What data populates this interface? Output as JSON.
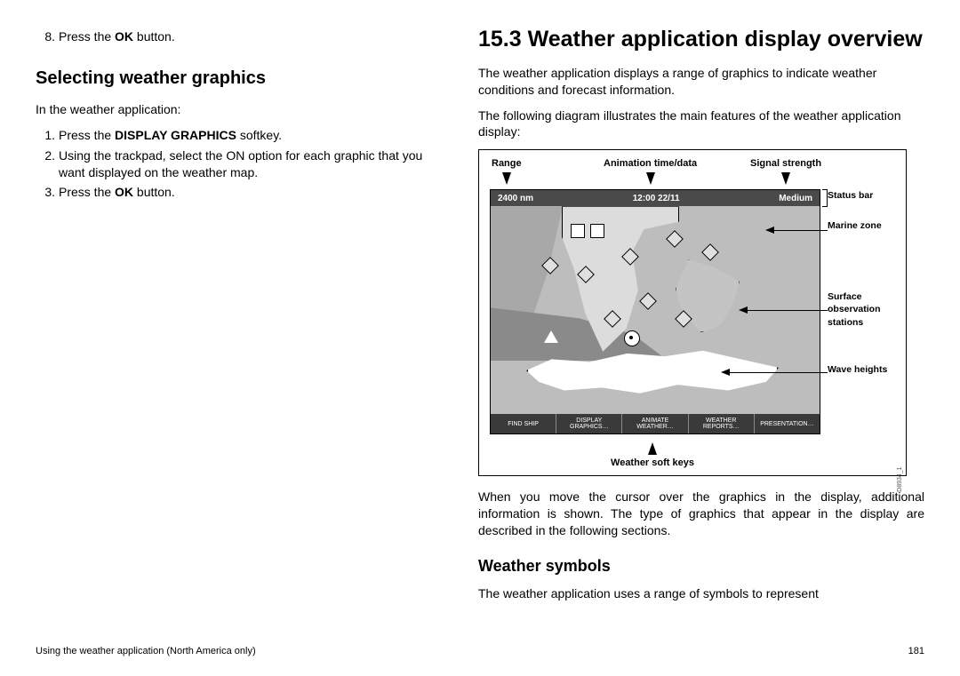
{
  "left": {
    "step8_pre": "Press the ",
    "step8_bold": "OK",
    "step8_post": " button.",
    "heading": "Selecting weather graphics",
    "intro": "In the weather application:",
    "s1_pre": "Press the ",
    "s1_bold": "DISPLAY GRAPHICS",
    "s1_post": " softkey.",
    "s2": "Using the trackpad, select the ON option for each graphic that you want displayed on the weather map.",
    "s3_pre": "Press the ",
    "s3_bold": "OK",
    "s3_post": " button."
  },
  "right": {
    "h1": "15.3 Weather application display overview",
    "p1": "The weather application displays a range of graphics to indicate weather conditions and forecast information.",
    "p2": "The following diagram illustrates the main features of the weather application display:",
    "p3": "When you move the cursor over the graphics in the display, additional information is shown. The type of graphics that appear in the display are described in the following sections.",
    "h3": "Weather symbols",
    "p4": "The weather application uses a range of symbols to represent"
  },
  "figure": {
    "top": {
      "range": "Range",
      "anim": "Animation time/data",
      "signal": "Signal strength"
    },
    "status": {
      "left": "2400 nm",
      "center": "12:00 22/11",
      "right": "Medium"
    },
    "softkeys": {
      "k1": "FIND SHIP",
      "k2a": "DISPLAY",
      "k2b": "GRAPHICS…",
      "k3a": "ANIMATE",
      "k3b": "WEATHER…",
      "k4a": "WEATHER",
      "k4b": "REPORTS…",
      "k5": "PRESENTATION…"
    },
    "right_labels": {
      "status": "Status bar",
      "marine": "Marine zone",
      "surface": "Surface observation stations",
      "wave": "Wave heights"
    },
    "bottom": "Weather soft keys",
    "code": "D8934_1"
  },
  "footer": {
    "left": "Using the weather application (North America only)",
    "right": "181"
  },
  "nums": {
    "n8": "8.",
    "n1": "1.",
    "n2": "2.",
    "n3": "3."
  }
}
